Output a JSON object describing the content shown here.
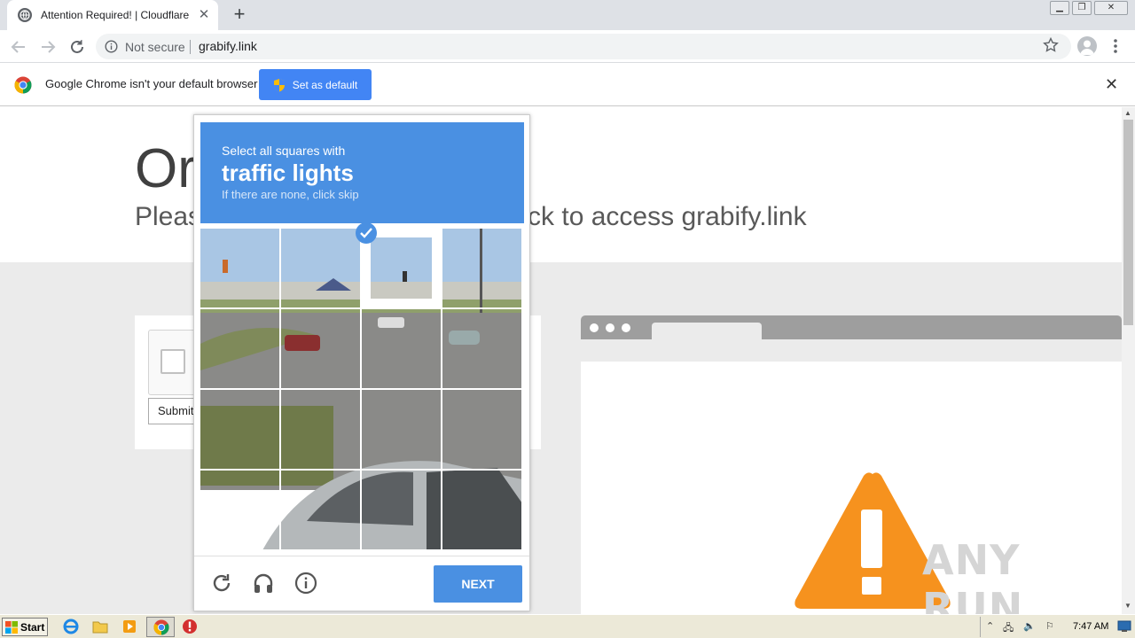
{
  "browser": {
    "tab_title": "Attention Required! | Cloudflare",
    "address": {
      "security_label": "Not secure",
      "url": "grabify.link"
    }
  },
  "infobar": {
    "message": "Google Chrome isn't your default browser",
    "button_label": "Set as default"
  },
  "page": {
    "heading_visible": "Or",
    "subtitle_left": "Pleas",
    "subtitle_right": "ck to access grabify.link",
    "submit_label": "Submit"
  },
  "recaptcha": {
    "instruction": "Select all squares with",
    "target": "traffic lights",
    "hint": "If there are none, click skip",
    "next_label": "NEXT",
    "selected_tile": 2,
    "colors": {
      "accent": "#4a90e2"
    }
  },
  "watermark": "ANY RUN",
  "taskbar": {
    "start_label": "Start",
    "clock": "7:47 AM"
  }
}
